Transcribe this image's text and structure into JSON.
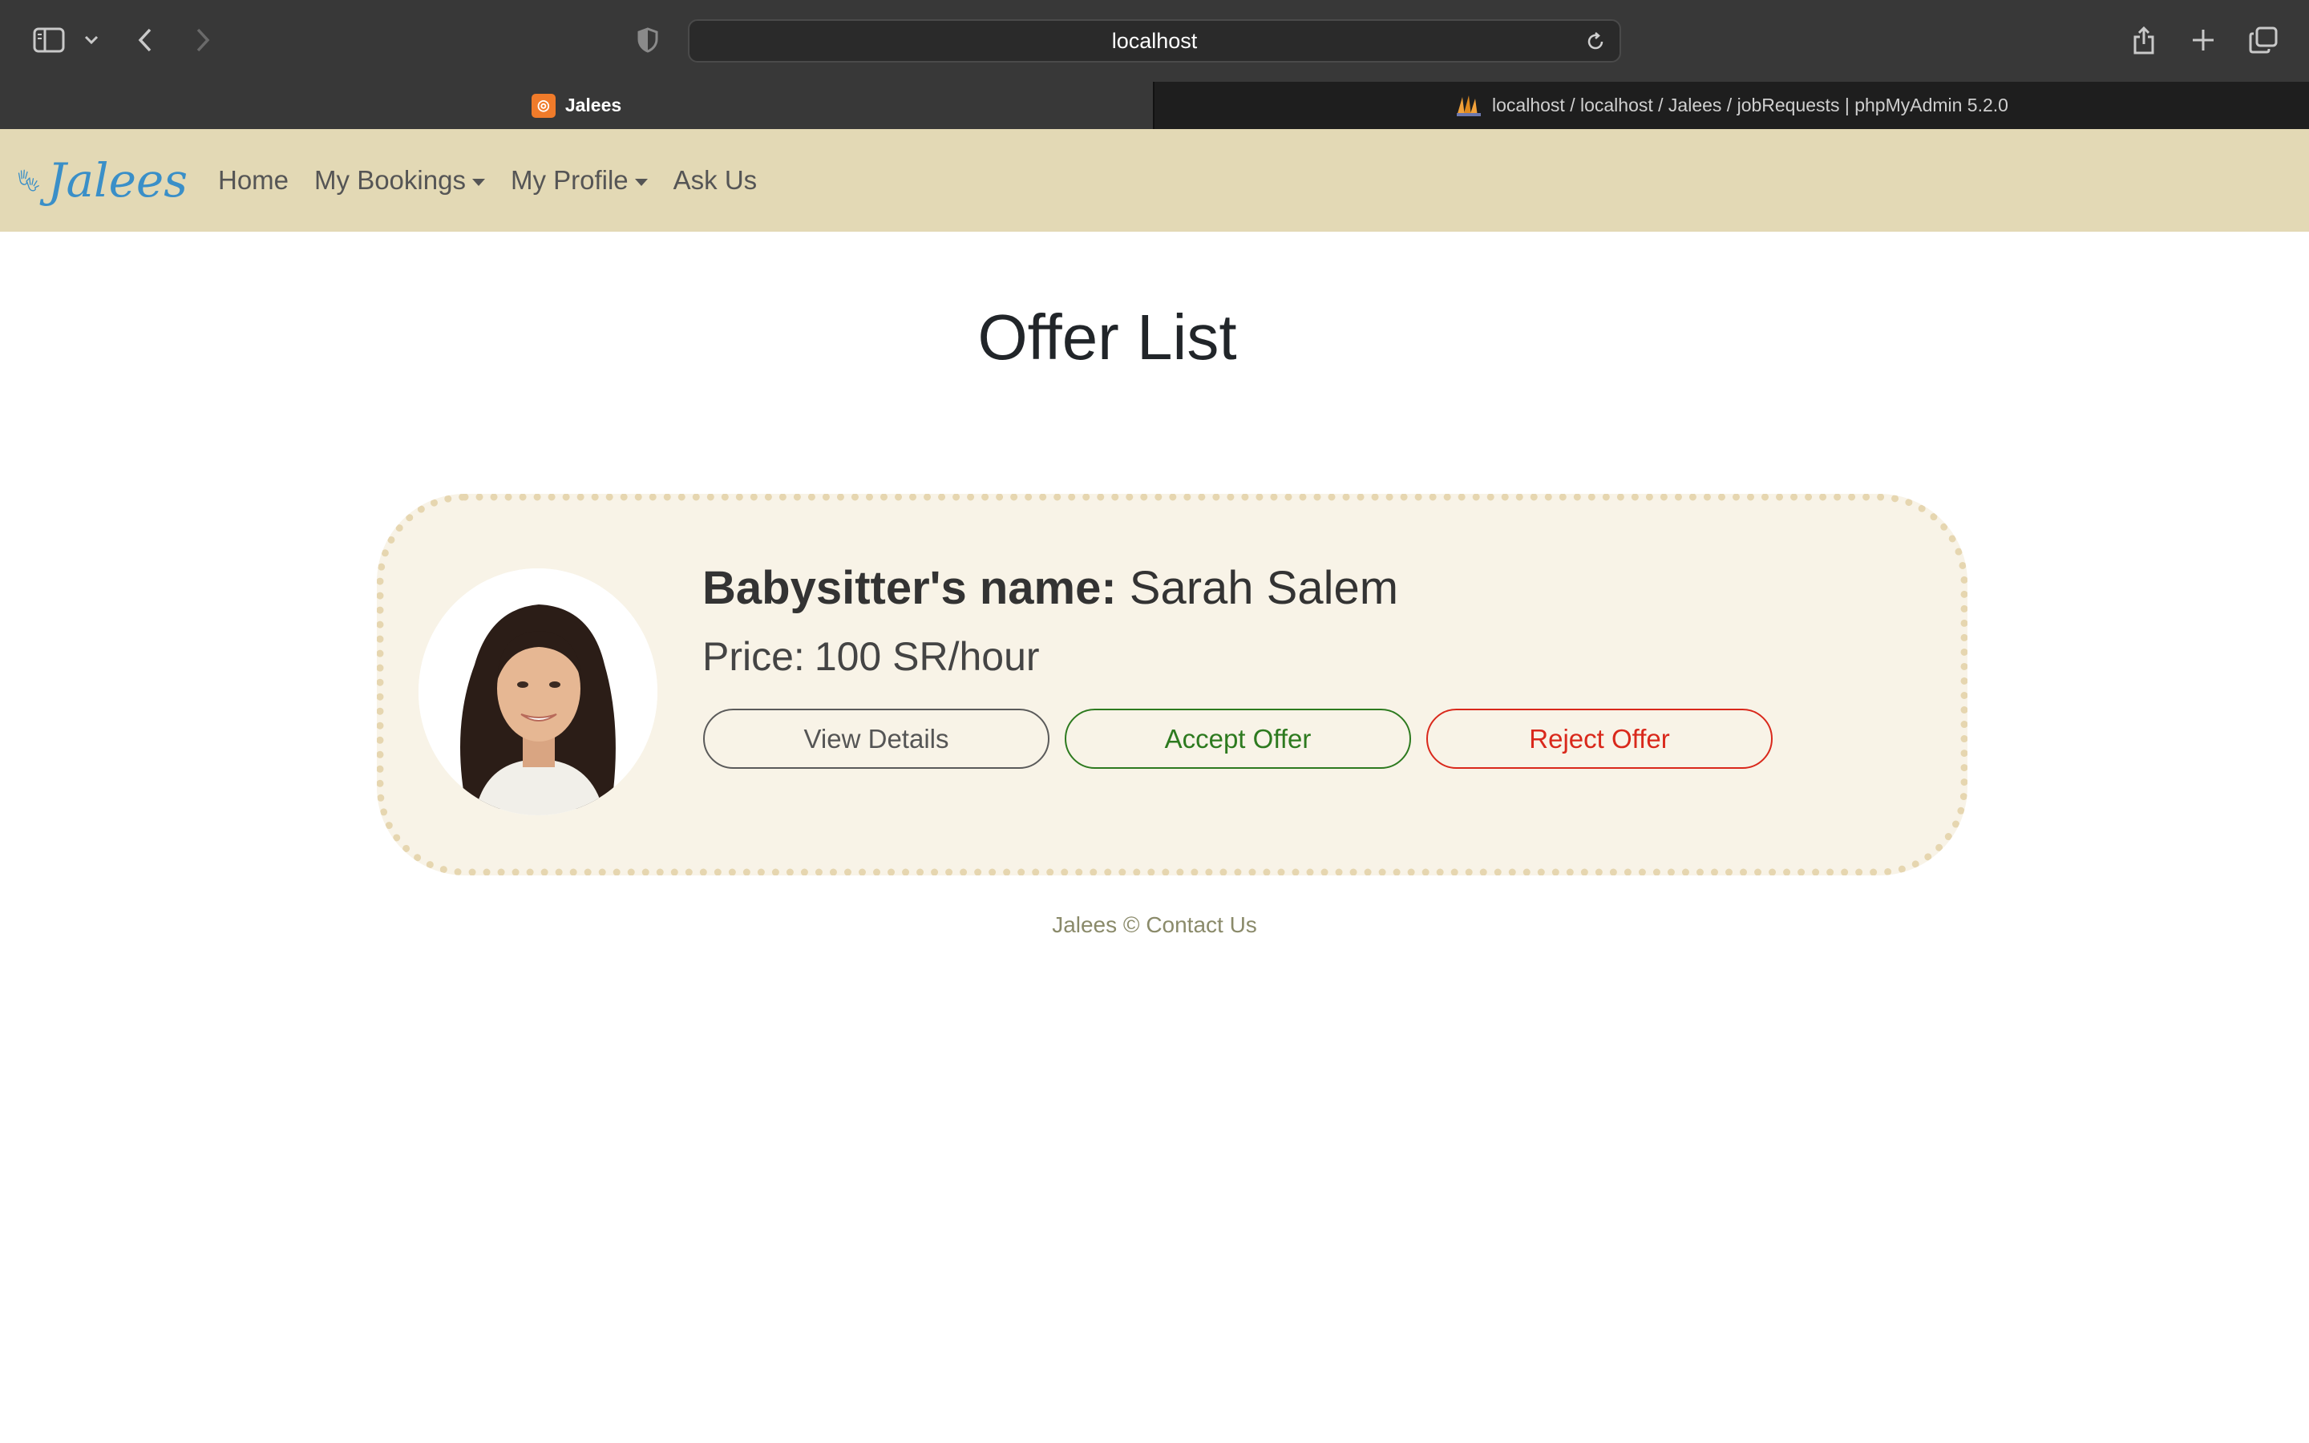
{
  "browser": {
    "url": "localhost",
    "tabs": [
      {
        "label": "Jalees",
        "favicon": "xampp-icon"
      },
      {
        "label": "localhost / localhost / Jalees / jobRequests | phpMyAdmin 5.2.0",
        "favicon": "phpmyadmin-icon"
      }
    ]
  },
  "nav": {
    "logo_text": "Jalees",
    "items": [
      {
        "label": "Home",
        "dropdown": false
      },
      {
        "label": "My Bookings",
        "dropdown": true
      },
      {
        "label": "My Profile",
        "dropdown": true
      },
      {
        "label": "Ask Us",
        "dropdown": false
      }
    ]
  },
  "main": {
    "title": "Offer List",
    "offer": {
      "name_label": "Babysitter's name:",
      "name_value": "Sarah Salem",
      "price_label": "Price:",
      "price_value": "100 SR/hour",
      "buttons": {
        "view": "View Details",
        "accept": "Accept Offer",
        "reject": "Reject Offer"
      }
    }
  },
  "footer": {
    "text": "Jalees © Contact Us"
  },
  "colors": {
    "nav_bg": "#e3d9b5",
    "card_bg": "#f8f3e7",
    "card_border": "#e6d6b0",
    "accept": "#2d7a1f",
    "reject": "#d9281b",
    "logo": "#3a8fc8"
  }
}
